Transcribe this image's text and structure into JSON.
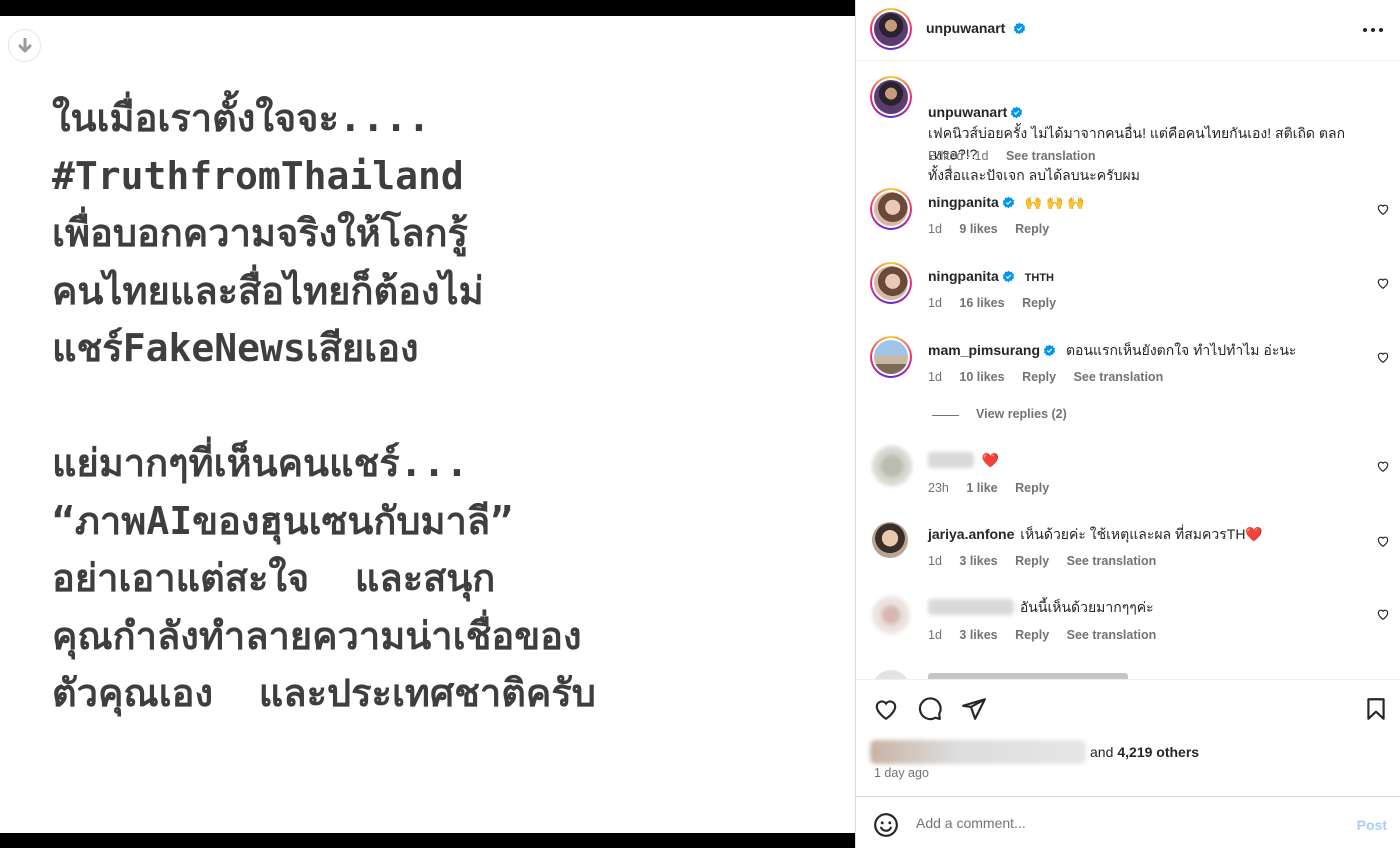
{
  "post": {
    "image_text": "ในเมื่อเราตั้งใจจะ....\n#TruthfromThailand\nเพื่อบอกความจริงให้โลกรู้\nคนไทยและสื่อไทยก็ต้องไม่\nแชร์FakeNewsเสียเอง\n\nแย่มากๆที่เห็นคนแชร์...\n“ภาพAIของฮุนเซนกับมาลี”\nอย่าเอาแต่สะใจ  และสนุก\nคุณกำลังทำลายความน่าเชื่อของ\nตัวคุณเอง  และประเทศชาติครับ"
  },
  "header": {
    "username": "unpuwanart"
  },
  "caption": {
    "username": "unpuwanart",
    "text": "เฟคนิวส์บ่อยครั้ง ไม่ได้มาจากคนอื่น! แต่คือคนไทยกันเอง! สติเถิด ตลกเหรอ?!?\nทั้งสื่อและปัจเจก ลบได้ลบนะครับผม",
    "edited": "Edited · 1d",
    "see_translation": "See translation"
  },
  "comments": [
    {
      "username": "ningpanita",
      "text": "🙌 🙌 🙌",
      "time": "1d",
      "likes": "9 likes",
      "reply": "Reply"
    },
    {
      "username": "ningpanita",
      "text": "THTH",
      "time": "1d",
      "likes": "16 likes",
      "reply": "Reply"
    },
    {
      "username": "mam_pimsurang",
      "text": "ตอนแรกเห็นยังตกใจ ทำไปทำไม อ่ะนะ",
      "time": "1d",
      "likes": "10 likes",
      "reply": "Reply",
      "see_translation": "See translation",
      "view_replies": "View replies (2)"
    },
    {
      "text": "❤️",
      "time": "23h",
      "likes": "1 like",
      "reply": "Reply"
    },
    {
      "username": "jariya.anfone",
      "text": "เห็นด้วยค่ะ ใช้เหตุและผล ที่สมควรTH❤️",
      "time": "1d",
      "likes": "3 likes",
      "reply": "Reply",
      "see_translation": "See translation"
    },
    {
      "text": "อันนี้เห็นด้วยมากๆๆค่ะ",
      "time": "1d",
      "likes": "3 likes",
      "reply": "Reply",
      "see_translation": "See translation"
    }
  ],
  "likes": {
    "and": "and",
    "others": "4,219 others"
  },
  "date": "1 day ago",
  "add_comment": {
    "placeholder": "Add a comment...",
    "post": "Post"
  },
  "colors": {
    "verified": "#0095f6",
    "post_disabled": "#a9cff5",
    "meta": "#737373"
  }
}
